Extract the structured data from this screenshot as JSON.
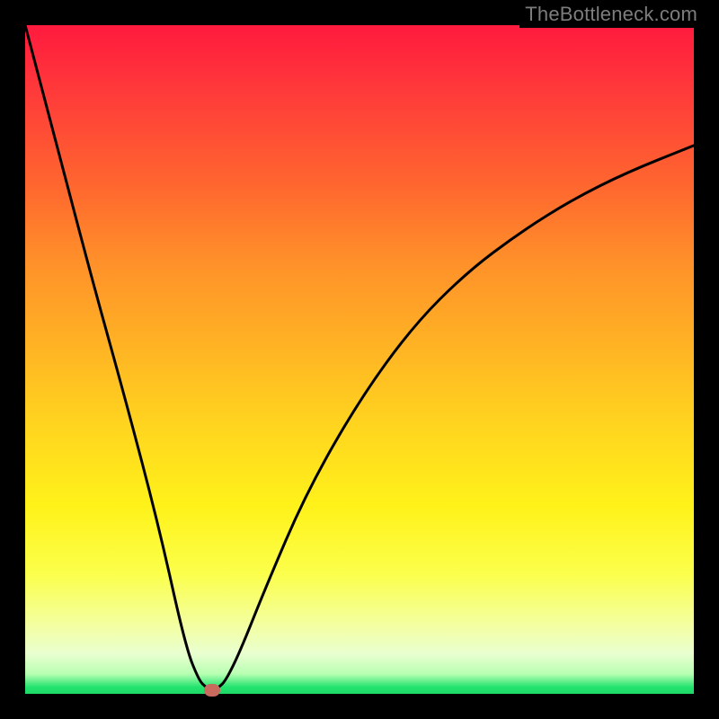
{
  "watermark": "TheBottleneck.com",
  "chart_data": {
    "type": "line",
    "title": "",
    "xlabel": "",
    "ylabel": "",
    "xlim": [
      0,
      100
    ],
    "ylim": [
      0,
      100
    ],
    "series": [
      {
        "name": "curve",
        "x": [
          0,
          5,
          10,
          15,
          20,
          24,
          26,
          27,
          28,
          29,
          30,
          32,
          36,
          42,
          50,
          58,
          66,
          74,
          82,
          90,
          100
        ],
        "y": [
          100,
          81,
          62,
          44,
          25,
          7,
          2,
          1,
          0.5,
          1,
          2,
          6,
          16,
          30,
          44,
          55,
          63,
          69,
          74,
          78,
          82
        ]
      }
    ],
    "marker": {
      "x": 28,
      "y": 0.5,
      "color": "#c96a5e"
    },
    "gradient_colors": [
      "#ff1a3e",
      "#ff6a2e",
      "#ffd51f",
      "#fff21a",
      "#22e36e"
    ]
  }
}
